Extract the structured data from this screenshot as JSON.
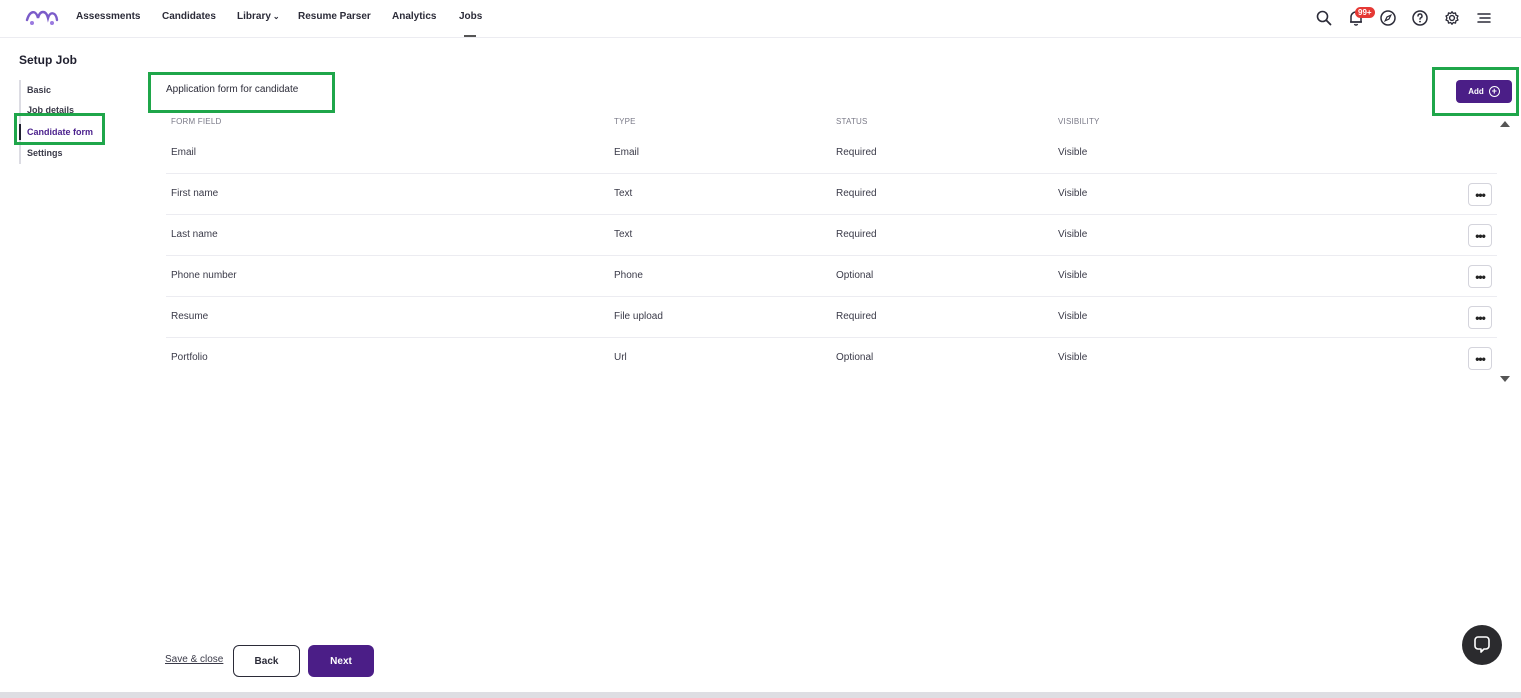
{
  "nav": {
    "items": [
      {
        "label": "Assessments"
      },
      {
        "label": "Candidates"
      },
      {
        "label": "Library"
      },
      {
        "label": "Resume Parser"
      },
      {
        "label": "Analytics"
      },
      {
        "label": "Jobs"
      }
    ],
    "notification_badge": "99+",
    "icons": [
      "search-icon",
      "bell-icon",
      "compass-icon",
      "help-icon",
      "gear-icon",
      "menu-icon"
    ]
  },
  "sidebar": {
    "title": "Setup Job",
    "items": [
      {
        "label": "Basic"
      },
      {
        "label": "Job details"
      },
      {
        "label": "Candidate form"
      },
      {
        "label": "Settings"
      }
    ],
    "active": "Candidate form"
  },
  "main": {
    "form_title": "Application form for candidate",
    "add_label": "Add",
    "columns": [
      "FORM FIELD",
      "TYPE",
      "STATUS",
      "VISIBILITY"
    ],
    "rows": [
      {
        "field": "Email",
        "type": "Email",
        "status": "Required",
        "visibility": "Visible"
      },
      {
        "field": "First name",
        "type": "Text",
        "status": "Required",
        "visibility": "Visible"
      },
      {
        "field": "Last name",
        "type": "Text",
        "status": "Required",
        "visibility": "Visible"
      },
      {
        "field": "Phone number",
        "type": "Phone",
        "status": "Optional",
        "visibility": "Visible"
      },
      {
        "field": "Resume",
        "type": "File upload",
        "status": "Required",
        "visibility": "Visible"
      },
      {
        "field": "Portfolio",
        "type": "Url",
        "status": "Optional",
        "visibility": "Visible"
      }
    ]
  },
  "footer": {
    "save_close": "Save & close",
    "back": "Back",
    "next": "Next"
  },
  "colors": {
    "brand": "#4b1e87",
    "highlight": "#1fa64a",
    "badge": "#e53935"
  }
}
